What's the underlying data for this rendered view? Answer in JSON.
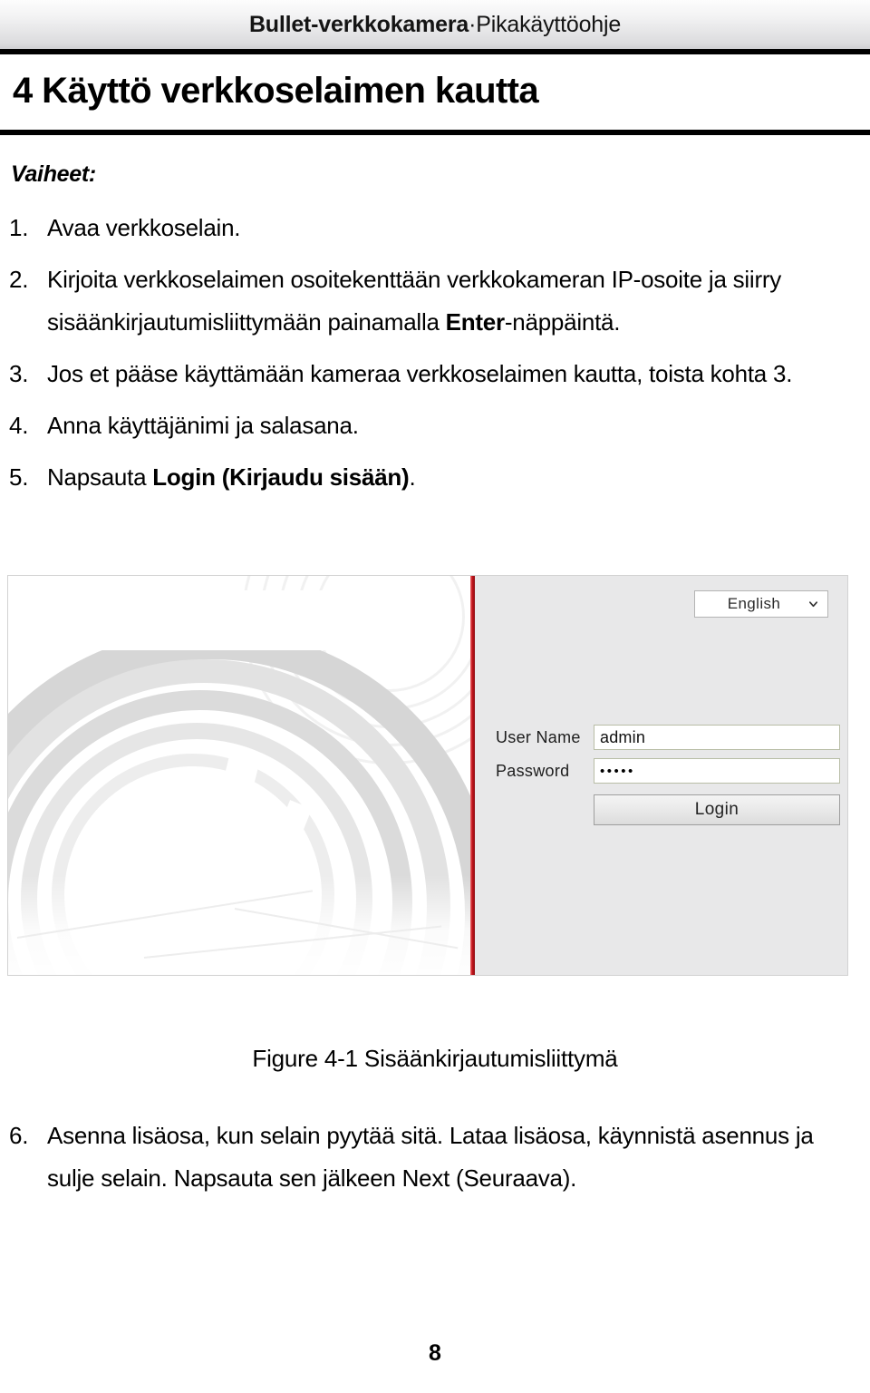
{
  "header": {
    "title_bold": "Bullet-verkkokamera",
    "title_regular": "·Pikakäyttöohje"
  },
  "chapter": {
    "title": "4 Käyttö verkkoselaimen kautta"
  },
  "steps": {
    "label": "Vaiheet:",
    "items": [
      {
        "number": "1.",
        "text": "Avaa verkkoselain."
      },
      {
        "number": "2.",
        "text_before": "Kirjoita verkkoselaimen osoitekenttään verkkokameran IP-osoite ja siirry sisäänkirjautumisliittymään painamalla ",
        "text_bold": "Enter",
        "text_after": "-näppäintä."
      },
      {
        "number": "3.",
        "text": "Jos et pääse käyttämään kameraa verkkoselaimen kautta, toista kohta 3."
      },
      {
        "number": "4.",
        "text": "Anna käyttäjänimi ja salasana."
      },
      {
        "number": "5.",
        "text_before": "Napsauta ",
        "text_bold": "Login (Kirjaudu sisään)",
        "text_after": "."
      }
    ],
    "item6": {
      "number": "6.",
      "text": "Asenna lisäosa, kun selain pyytää sitä. Lataa lisäosa, käynnistä asennus ja sulje selain. Napsauta sen jälkeen Next (Seuraava)."
    }
  },
  "login_screenshot": {
    "language_select": {
      "value": "English",
      "chevron_icon": "chevron-down-icon"
    },
    "user_name": {
      "label": "User Name",
      "value": "admin"
    },
    "password": {
      "label": "Password",
      "value": "•••••"
    },
    "login_button": {
      "label": "Login"
    },
    "accent_color": "#c0121a",
    "panel_color": "#e8e8e9"
  },
  "figure": {
    "caption": "Figure 4-1 Sisäänkirjautumisliittymä"
  },
  "footer": {
    "page_number": "8"
  }
}
